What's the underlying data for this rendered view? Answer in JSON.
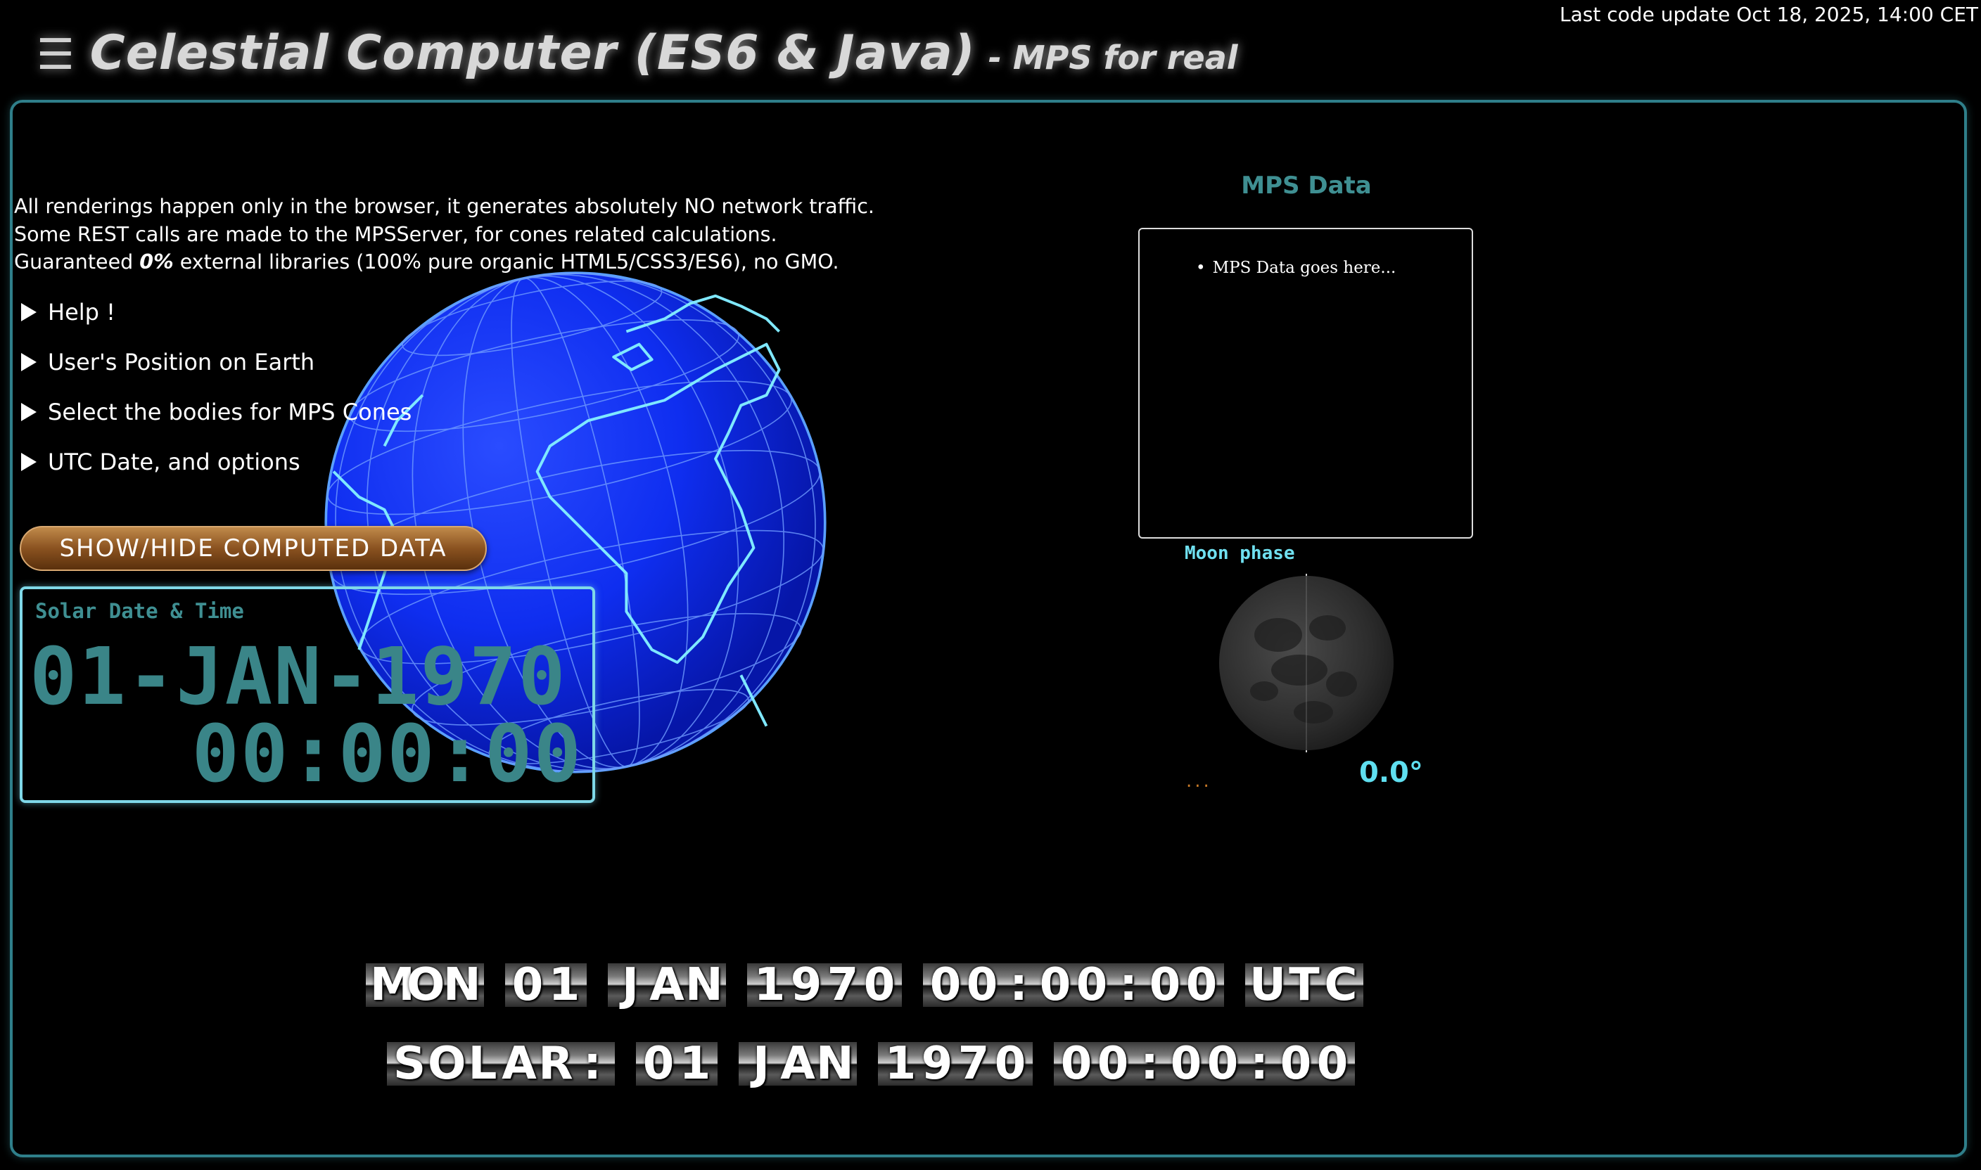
{
  "header": {
    "menu_icon": "hamburger-icon",
    "title": "Celestial Computer (ES6 & Java)",
    "subtitle": "- MPS for real",
    "last_update": "Last code update Oct 18, 2025, 14:00 CET"
  },
  "intro": {
    "line1": "All renderings happen only in the browser, it generates absolutely NO network traffic.",
    "line2": "Some REST calls are made to the MPSServer, for cones related calculations.",
    "line3_pre": "Guaranteed ",
    "line3_bold": "0%",
    "line3_post": " external libraries (100% pure organic HTML5/CSS3/ES6), no GMO."
  },
  "sections": [
    {
      "label": "Help !"
    },
    {
      "label": "User's Position on Earth"
    },
    {
      "label": "Select the bodies for MPS Cones"
    },
    {
      "label": "UTC Date, and options"
    }
  ],
  "toggle_button": {
    "label": "SHOW/HIDE COMPUTED DATA"
  },
  "solar_box": {
    "label": "Solar Date & Time",
    "date": "01-JAN-1970",
    "time": "00:00:00"
  },
  "mps": {
    "title": "MPS Data",
    "items": [
      "MPS Data goes here..."
    ]
  },
  "moon": {
    "label": "Moon phase",
    "angle": "0.0°",
    "dots": "..."
  },
  "flap_utc": [
    "MON",
    "01",
    "JAN",
    "1970",
    "00:00:00",
    "UTC"
  ],
  "flap_solar": [
    "SOLAR:",
    "01",
    "JAN",
    "1970",
    "00:00:00"
  ],
  "colors": {
    "frame": "#2f7f8a",
    "accent": "#3f8f92",
    "moon_accent": "#6fe0f0",
    "globe": "#0a28e6",
    "button": "#8a5220"
  }
}
